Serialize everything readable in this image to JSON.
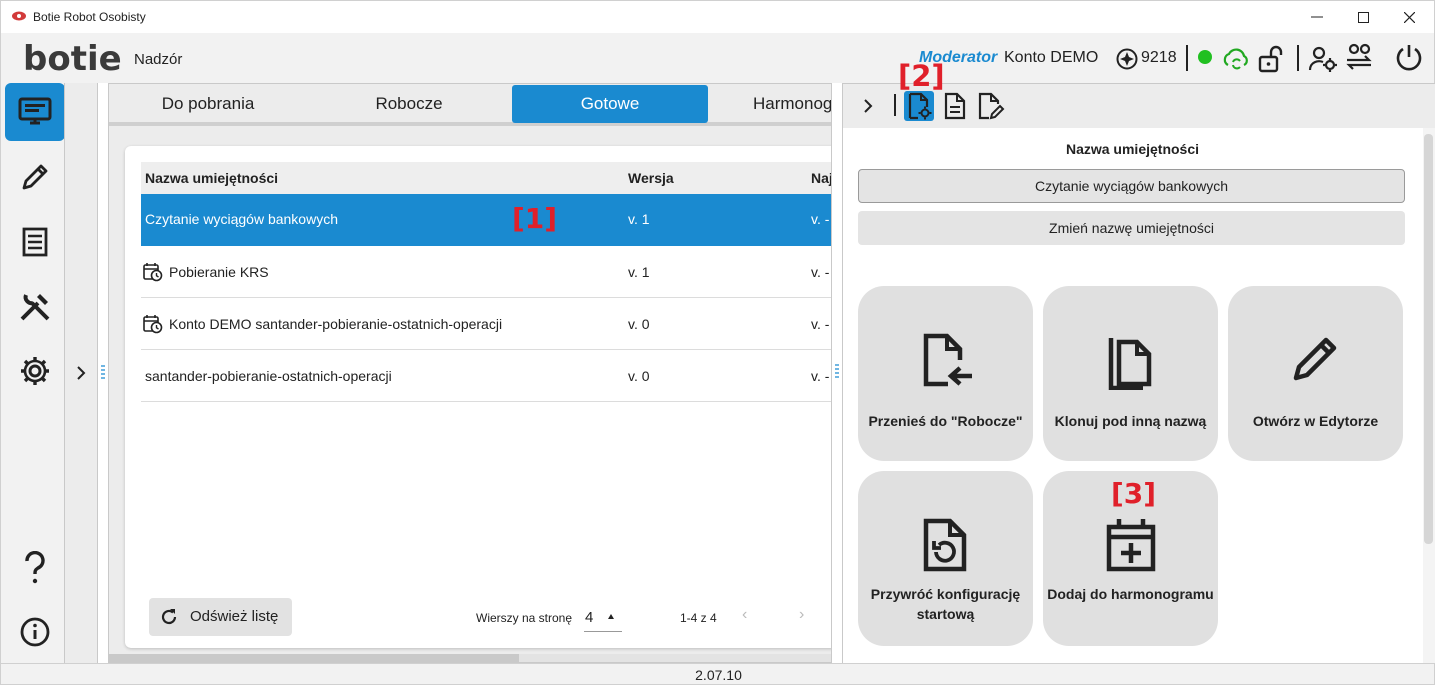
{
  "window": {
    "title": "Botie Robot Osobisty",
    "controls": {
      "minimize": "–",
      "maximize": "☐",
      "close": "✕"
    }
  },
  "header": {
    "logo": "botie",
    "section": "Nadzór",
    "role": "Moderator",
    "account": "Konto DEMO",
    "credits": "9218",
    "status_color": "#21c021",
    "icons": [
      "credits-icon",
      "status-dot",
      "cloud-sync-icon",
      "lock-open-icon",
      "user-settings-icon",
      "users-switch-icon",
      "power-icon"
    ]
  },
  "sidebar": {
    "items": [
      {
        "name": "monitor",
        "icon": "monitor-icon",
        "active": true
      },
      {
        "name": "edit",
        "icon": "pencil-icon",
        "active": false
      },
      {
        "name": "list",
        "icon": "receipt-icon",
        "active": false
      },
      {
        "name": "tools",
        "icon": "tools-icon",
        "active": false
      },
      {
        "name": "settings",
        "icon": "gear-icon",
        "active": false
      },
      {
        "name": "help",
        "icon": "help-icon",
        "active": false
      },
      {
        "name": "info",
        "icon": "info-icon",
        "active": false
      }
    ]
  },
  "tabs": [
    {
      "label": "Do pobrania",
      "active": false
    },
    {
      "label": "Robocze",
      "active": false
    },
    {
      "label": "Gotowe",
      "active": true
    },
    {
      "label": "Harmonog",
      "active": false
    }
  ],
  "table": {
    "columns": [
      "Nazwa umiejętności",
      "Wersja",
      "Naj"
    ],
    "rows": [
      {
        "name": "Czytanie wyciągów bankowych",
        "version": "v. 1",
        "extra": "v. -",
        "scheduled": false,
        "selected": true
      },
      {
        "name": "Pobieranie KRS",
        "version": "v. 1",
        "extra": "v. -",
        "scheduled": true,
        "selected": false
      },
      {
        "name": "Konto DEMO santander-pobieranie-ostatnich-operacji",
        "version": "v. 0",
        "extra": "v. -",
        "scheduled": true,
        "selected": false
      },
      {
        "name": "santander-pobieranie-ostatnich-operacji",
        "version": "v. 0",
        "extra": "v. -",
        "scheduled": false,
        "selected": false
      }
    ]
  },
  "footer": {
    "refresh": "Odśwież listę",
    "rows_per_page_label": "Wierszy na stronę",
    "rows_per_page": "4",
    "range": "1-4 z 4",
    "prev": "‹",
    "next": "›"
  },
  "annotations": {
    "a1": "[1]",
    "a2": "[2]",
    "a3": "[3]"
  },
  "panel": {
    "toggle": "›",
    "skill_label": "Nazwa umiejętności",
    "skill_name": "Czytanie wyciągów bankowych",
    "rename": "Zmień nazwę umiejętności",
    "actions": [
      {
        "label": "Przenieś do \"Robocze\"",
        "icon": "move-file-icon"
      },
      {
        "label": "Klonuj pod inną nazwą",
        "icon": "copy-icon"
      },
      {
        "label": "Otwórz w Edytorze",
        "icon": "pencil-icon"
      },
      {
        "label": "Przywróć konfigurację startową",
        "icon": "restore-file-icon"
      },
      {
        "label": "Dodaj do harmonogramu",
        "icon": "calendar-add-icon"
      }
    ]
  },
  "version": "2.07.10",
  "colors": {
    "accent": "#1a8ad0",
    "annotation": "#e0202a"
  }
}
